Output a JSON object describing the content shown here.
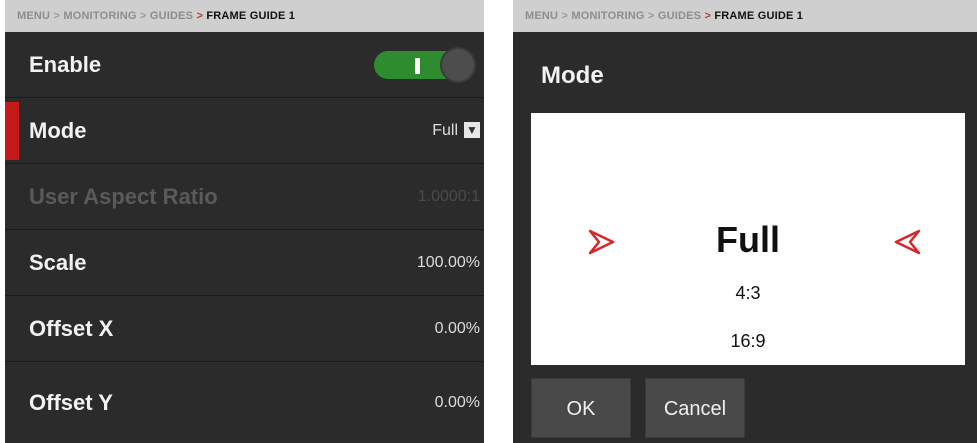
{
  "left": {
    "breadcrumb": {
      "item1": "MENU",
      "item2": "MONITORING",
      "item3": "GUIDES",
      "current": "FRAME GUIDE 1",
      "sep": ">"
    },
    "rows": [
      {
        "label": "Enable",
        "value": "",
        "state": "on"
      },
      {
        "label": "Mode",
        "value": "Full"
      },
      {
        "label": "User Aspect Ratio",
        "value": "1.0000:1"
      },
      {
        "label": "Scale",
        "value": "100.00%"
      },
      {
        "label": "Offset X",
        "value": "0.00%"
      },
      {
        "label": "Offset Y",
        "value": "0.00%"
      }
    ]
  },
  "right": {
    "breadcrumb": {
      "item1": "MENU",
      "item2": "MONITORING",
      "item3": "GUIDES",
      "current": "FRAME GUIDE 1",
      "sep": ">"
    },
    "title": "Mode",
    "options": {
      "selected": "Full",
      "next1": "4:3",
      "next2": "16:9"
    },
    "buttons": {
      "ok": "OK",
      "cancel": "Cancel"
    }
  },
  "colors": {
    "accent": "#c61a1a",
    "toggle_on": "#2e8b2e",
    "panel_bg": "#2b2b2b",
    "breadcrumb_bg": "#cfcfcf"
  },
  "icons": {
    "dropdown": "chevron-down-icon",
    "left_arrow": "chevron-right-icon",
    "right_arrow": "chevron-left-icon"
  }
}
